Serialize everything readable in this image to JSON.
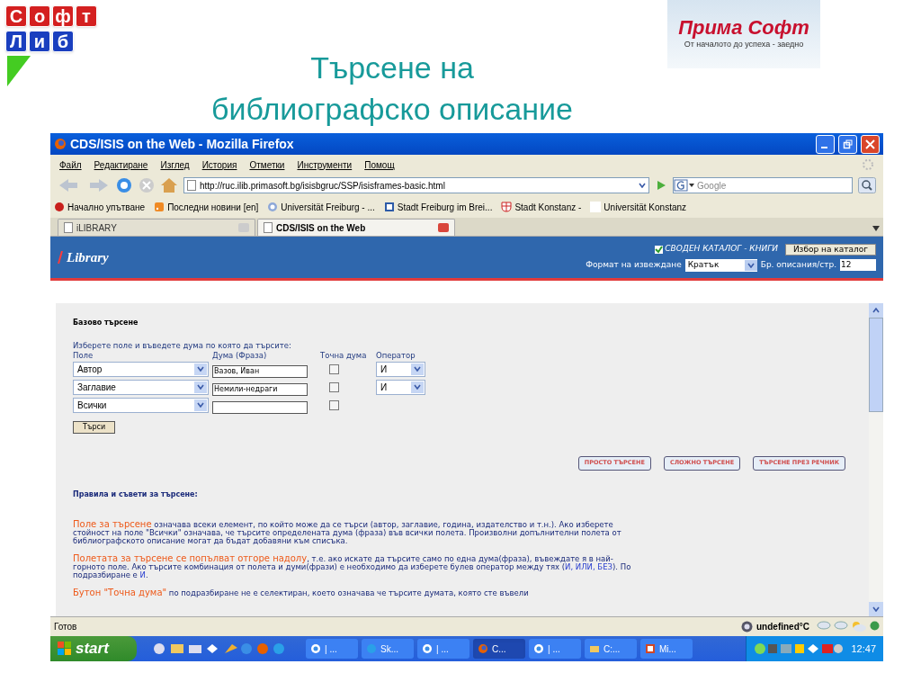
{
  "slide": {
    "logo_letters": [
      {
        "text": "С",
        "color": "#d42020"
      },
      {
        "text": "о",
        "color": "#d42020"
      },
      {
        "text": "ф",
        "color": "#d42020"
      },
      {
        "text": "т",
        "color": "#d42020"
      },
      {
        "text": "Л",
        "color": "#1a3fbf"
      },
      {
        "text": "и",
        "color": "#1a3fbf"
      },
      {
        "text": "б",
        "color": "#1a3fbf"
      }
    ],
    "title_lines": [
      "Търсене на",
      "библиографско описание"
    ],
    "brand": {
      "name": "Прима Софт",
      "tagline": "От началото до успеха - заедно"
    }
  },
  "window": {
    "title": "CDS/ISIS on the Web - Mozilla Firefox",
    "menu": [
      "Файл",
      "Редактиране",
      "Изглед",
      "История",
      "Отметки",
      "Инструменти",
      "Помощ"
    ],
    "url": "http://ruc.ilib.primasoft.bg/isisbgruc/SSP/isisframes-basic.html",
    "search": {
      "placeholder": "Google"
    },
    "bookmarks": [
      {
        "label": "Начално упътване",
        "kind": "bug"
      },
      {
        "label": "Последни новини [en]",
        "kind": "rss"
      },
      {
        "label": "Universität Freiburg - ...",
        "kind": "seal"
      },
      {
        "label": "Stadt Freiburg im Brei...",
        "kind": "page"
      },
      {
        "label": "Stadt Konstanz -",
        "kind": "shield"
      },
      {
        "label": "Universität Konstanz",
        "kind": "blank"
      }
    ],
    "tabs": [
      {
        "label": "iLIBRARY",
        "selected": false
      },
      {
        "label": "CDS/ISIS on the Web",
        "selected": true
      }
    ]
  },
  "library_header": {
    "logo": "Library",
    "catalog_checked": true,
    "catalog": "СВОДЕН КАТАЛОГ - КНИГИ",
    "catalog_button": "Избор на каталог",
    "format_label": "Формат на извеждане",
    "format_value": "Кратък",
    "count_label": "Бр. описания/стр.",
    "count_value": "12"
  },
  "basic_search": {
    "heading": "Базово търсене",
    "instruction": "Изберете поле и въведете дума по която да търсите:",
    "columns": [
      "Поле",
      "Дума (Фраза)",
      "Точна дума",
      "Оператор"
    ],
    "rows": [
      {
        "field": "Автор",
        "term": "Вазов, Иван",
        "exact": false,
        "operator": "И"
      },
      {
        "field": "Заглавие",
        "term": "Немили-недраги",
        "exact": false,
        "operator": "И"
      },
      {
        "field": "Всички",
        "exact": false
      }
    ],
    "search_button": "Търси"
  },
  "mode_buttons": [
    "ПРОСТО ТЪРСЕНЕ",
    "СЛОЖНО ТЪРСЕНЕ",
    "ТЪРСЕНЕ ПРЕЗ РЕЧНИК"
  ],
  "rules": {
    "heading": "Правила и съвети за търсене:",
    "paragraphs": [
      [
        {
          "kind": "accent",
          "text": "Поле за търсене"
        },
        {
          "kind": "plain",
          "text": " означава всеки елемент, по който може да се търси (автор, заглавие, година, издателство и т.н.). Ако изберете стойност на поле \"Всички\" означава, че търсите определената дума (фраза) във всички полета. Произволни допълнителни полета от библиографското описание могат да бъдат добавяни към списъка."
        }
      ],
      [
        {
          "kind": "accent",
          "text": "Полетата за търсене се попълват отгоре надолу"
        },
        {
          "kind": "plain",
          "text": ", т.е. ако искате да търсите само по една дума(фраза), въвеждате я в най-горното поле. Ако търсите комбинация от полета и думи(фрази) е необходимо да изберете булев оператор между тях ("
        },
        {
          "kind": "link",
          "text": "И, ИЛИ, БЕЗ"
        },
        {
          "kind": "plain",
          "text": "). По подразбиране е "
        },
        {
          "kind": "link",
          "text": "И"
        },
        {
          "kind": "plain",
          "text": "."
        }
      ],
      [
        {
          "kind": "accent",
          "text": "Бутон \"Точна дума\""
        },
        {
          "kind": "plain",
          "text": " по подразбиране не е селектиран, което означава че търсите думата, която сте въвели"
        }
      ]
    ]
  },
  "status_bar": {
    "text": "Готов",
    "weather": "undefined°C"
  },
  "taskbar": {
    "start": "start",
    "tasks": [
      {
        "label": "| ...",
        "kind": "chat",
        "selected": false
      },
      {
        "label": "Sk...",
        "kind": "skype",
        "selected": false
      },
      {
        "label": "| ...",
        "kind": "chat",
        "selected": false
      },
      {
        "label": "C...",
        "kind": "firefox",
        "selected": true
      },
      {
        "label": "| ...",
        "kind": "chat",
        "selected": false
      },
      {
        "label": "C:...",
        "kind": "folder",
        "selected": false
      },
      {
        "label": "Mi...",
        "kind": "slides",
        "selected": false
      }
    ],
    "clock": "12:47"
  }
}
